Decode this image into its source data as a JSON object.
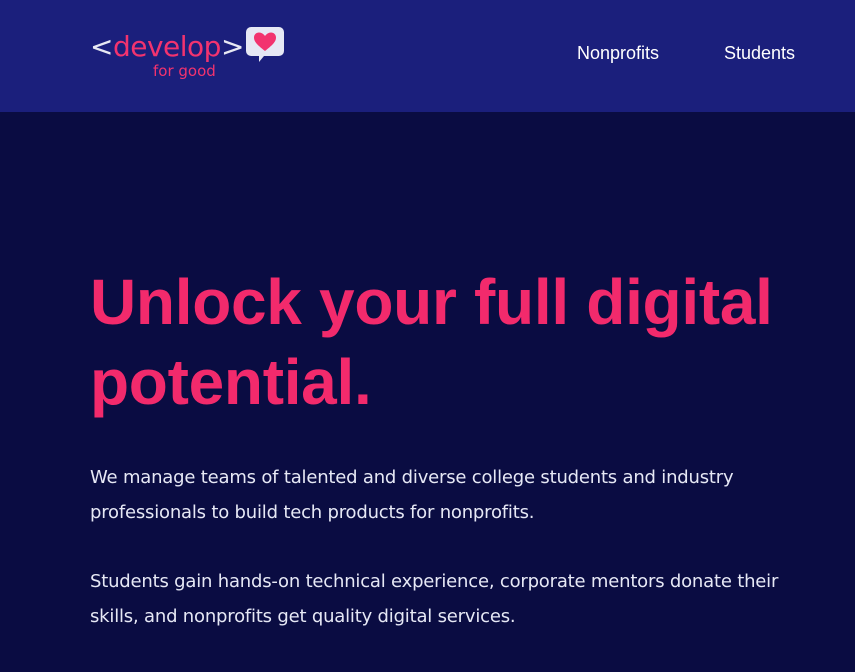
{
  "header": {
    "logo": {
      "bracket_open": "<",
      "word": "develop",
      "bracket_close": ">",
      "sub": "for good",
      "bubble_icon": "heart-speech-bubble-icon"
    },
    "nav": [
      {
        "label": "Nonprofits"
      },
      {
        "label": "Students"
      }
    ]
  },
  "main": {
    "headline": "Unlock your full digital potential.",
    "paragraphs": [
      "We manage teams of talented and diverse college students and industry professionals to build tech products for nonprofits.",
      "Students gain hands-on technical experience, corporate mentors donate their skills, and nonprofits get quality digital services."
    ]
  },
  "colors": {
    "header_bg": "#1b1f7c",
    "page_bg": "#0a0c42",
    "accent_pink": "#f22a6c",
    "text_light": "#e6e8f5"
  }
}
